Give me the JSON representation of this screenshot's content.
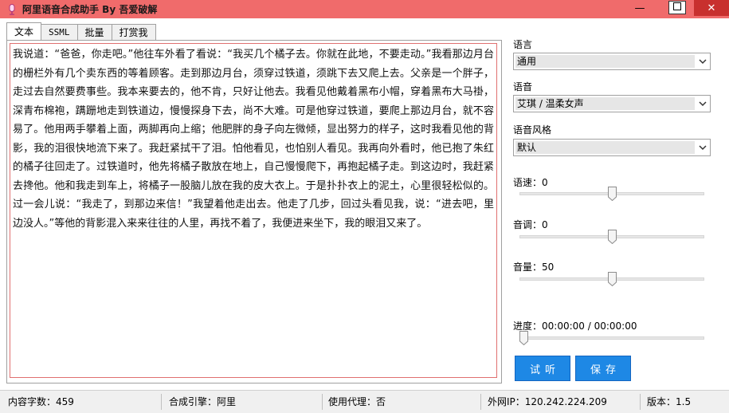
{
  "window": {
    "title": "阿里语音合成助手 By 吾爱破解",
    "minimize": "—",
    "maximize": "☐",
    "close": "✕"
  },
  "tabs": [
    {
      "label": "文本",
      "active": true
    },
    {
      "label": "SSML",
      "active": false
    },
    {
      "label": "批量",
      "active": false
    },
    {
      "label": "打赏我",
      "active": false
    }
  ],
  "text_content": "我说道：“爸爸，你走吧。”他往车外看了看说：“我买几个橘子去。你就在此地，不要走动。”我看那边月台的栅栏外有几个卖东西的等着顾客。走到那边月台，须穿过铁道，须跳下去又爬上去。父亲是一个胖子，走过去自然要费事些。我本来要去的，他不肯，只好让他去。我看见他戴着黑布小帽，穿着黑布大马褂，深青布棉袍，蹒跚地走到铁道边，慢慢探身下去，尚不大难。可是他穿过铁道，要爬上那边月台，就不容易了。他用两手攀着上面，两脚再向上缩；他肥胖的身子向左微倾，显出努力的样子，这时我看见他的背影，我的泪很快地流下来了。我赶紧拭干了泪。怕他看见，也怕别人看见。我再向外看时，他已抱了朱红的橘子往回走了。过铁道时，他先将橘子散放在地上，自己慢慢爬下，再抱起橘子走。到这边时，我赶紧去搀他。他和我走到车上，将橘子一股脑儿放在我的皮大衣上。于是扑扑衣上的泥土，心里很轻松似的。过一会儿说：“我走了，到那边来信！”我望着他走出去。他走了几步，回过头看见我，说：“进去吧，里边没人。”等他的背影混入来来往往的人里，再找不着了，我便进来坐下，我的眼泪又来了。",
  "settings": {
    "language_label": "语言",
    "language_value": "通用",
    "voice_label": "语音",
    "voice_value": "艾琪 / 温柔女声",
    "style_label": "语音风格",
    "style_value": "默认",
    "speed_label": "语速：",
    "speed_value": "0",
    "speed_level": 0.5,
    "pitch_label": "音调：",
    "pitch_value": "0",
    "pitch_level": 0.5,
    "volume_label": "音量：",
    "volume_value": "50",
    "volume_level": 0.5,
    "progress_label": "进度：",
    "progress_value": "00:00:00 / 00:00:00",
    "progress_level": 0
  },
  "buttons": {
    "try_label": "试听",
    "save_label": "保存"
  },
  "status": {
    "char_count_label": "内容字数：",
    "char_count_value": "459",
    "engine_label": "合成引擎：",
    "engine_value": "阿里",
    "proxy_label": "使用代理：",
    "proxy_value": "否",
    "ip_label": "外网IP：",
    "ip_value": "120.242.224.209",
    "version_label": "版本：",
    "version_value": "1.5"
  },
  "colors": {
    "titlebar": "#f06b6b",
    "accent_button": "#1e88e5",
    "close_button": "#c8302e"
  }
}
